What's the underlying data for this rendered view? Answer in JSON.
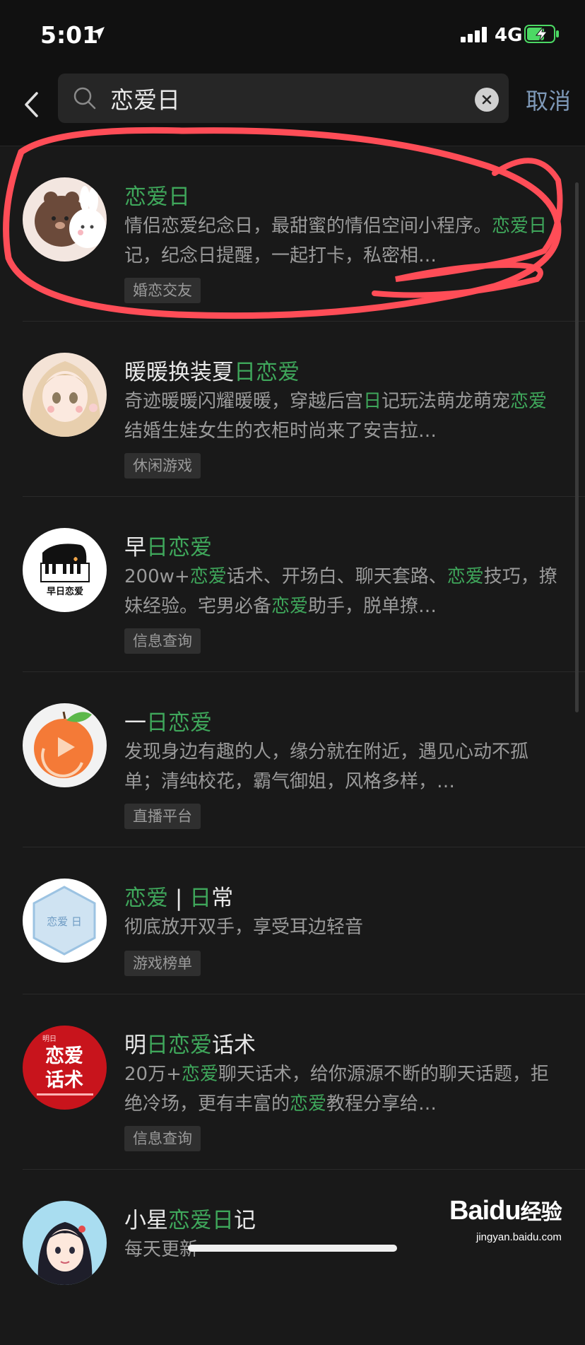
{
  "status_bar": {
    "time": "5:01",
    "network": "4G",
    "colors": {
      "battery": "#4cd964"
    }
  },
  "search": {
    "value": "恋爱日",
    "placeholder": "",
    "cancel_label": "取消"
  },
  "results": [
    {
      "title": [
        [
          "恋爱日",
          true
        ]
      ],
      "desc": [
        [
          "情侣恋爱纪念日，最甜蜜的情侣空间小程序。",
          false
        ],
        [
          "恋爱日",
          true
        ],
        [
          "记，纪念日提醒，一起打卡，私密相…",
          false
        ]
      ],
      "tag": "婚恋交友",
      "avatar": "bear-bunny-avatar"
    },
    {
      "title": [
        [
          "暖暖换装夏",
          false
        ],
        [
          "日恋爱",
          true
        ]
      ],
      "desc": [
        [
          "奇迹暖暖闪耀暖暖，穿越后宫",
          false
        ],
        [
          "日",
          true
        ],
        [
          "记玩法萌龙萌宠",
          false
        ],
        [
          "恋爱",
          true
        ],
        [
          "结婚生娃女生的衣柜时尚来了安吉拉…",
          false
        ]
      ],
      "tag": "休闲游戏",
      "avatar": "anime-girl-avatar"
    },
    {
      "title": [
        [
          "早",
          false
        ],
        [
          "日恋爱",
          true
        ]
      ],
      "desc": [
        [
          "200w+",
          false
        ],
        [
          "恋爱",
          true
        ],
        [
          "话术、开场白、聊天套路、",
          false
        ],
        [
          "恋爱",
          true
        ],
        [
          "技巧，撩妹经验。宅男必备",
          false
        ],
        [
          "恋爱",
          true
        ],
        [
          "助手，脱单撩…",
          false
        ]
      ],
      "tag": "信息查询",
      "avatar": "piano-logo-avatar"
    },
    {
      "title": [
        [
          "一",
          false
        ],
        [
          "日恋爱",
          true
        ]
      ],
      "desc": [
        [
          "发现身边有趣的人，缘分就在附近，遇见心动不孤单；清纯校花，霸气御姐，风格多样，…",
          false
        ]
      ],
      "tag": "直播平台",
      "avatar": "orange-play-avatar"
    },
    {
      "title": [
        [
          "恋爱",
          true
        ],
        [
          " | ",
          false
        ],
        [
          "日",
          true
        ],
        [
          "常",
          false
        ]
      ],
      "desc": [
        [
          "彻底放开双手，享受耳边轻音",
          false
        ]
      ],
      "tag": "游戏榜单",
      "avatar": "hexagon-logo-avatar"
    },
    {
      "title": [
        [
          "明",
          false
        ],
        [
          "日恋爱",
          true
        ],
        [
          "话术",
          false
        ]
      ],
      "desc": [
        [
          "20万+",
          false
        ],
        [
          "恋爱",
          true
        ],
        [
          "聊天话术，给你源源不断的聊天话题，拒绝冷场，更有丰富的",
          false
        ],
        [
          "恋爱",
          true
        ],
        [
          "教程分享给…",
          false
        ]
      ],
      "tag": "信息查询",
      "avatar": "red-text-logo-avatar"
    },
    {
      "title": [
        [
          "小星",
          false
        ],
        [
          "恋爱日",
          true
        ],
        [
          "记",
          false
        ]
      ],
      "desc": [
        [
          "每天更新",
          false
        ]
      ],
      "tag": "",
      "avatar": "cartoon-girl-avatar"
    }
  ],
  "avatar_text": {
    "piano": "早日恋爱",
    "hex": "恋爱  日",
    "red_top": "明日",
    "red_line1": "恋爱",
    "red_line2": "话术"
  },
  "watermark": {
    "logo_a": "Bai",
    "logo_b": "du",
    "logo_c": "经验",
    "url": "jingyan.baidu.com"
  },
  "colors": {
    "background": "#191919",
    "highlight": "#3fa75b",
    "cancel": "#7e99b8",
    "annotation": "#ff4d57"
  }
}
